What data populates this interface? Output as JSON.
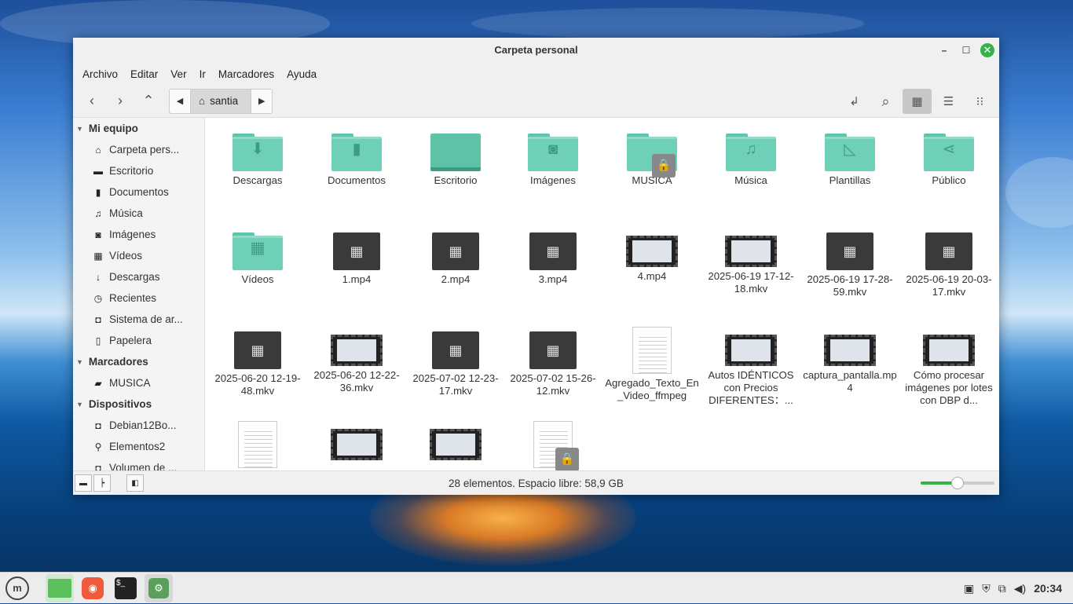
{
  "window": {
    "title": "Carpeta personal"
  },
  "menu": [
    "Archivo",
    "Editar",
    "Ver",
    "Ir",
    "Marcadores",
    "Ayuda"
  ],
  "path": {
    "current": "santia"
  },
  "sidebar": {
    "sections": [
      {
        "title": "Mi equipo",
        "items": [
          {
            "icon": "home-icon",
            "glyph": "⌂",
            "label": "Carpeta pers..."
          },
          {
            "icon": "desktop-icon",
            "glyph": "▬",
            "label": "Escritorio"
          },
          {
            "icon": "document-icon",
            "glyph": "▮",
            "label": "Documentos"
          },
          {
            "icon": "music-icon",
            "glyph": "♫",
            "label": "Música"
          },
          {
            "icon": "camera-icon",
            "glyph": "◙",
            "label": "Imágenes"
          },
          {
            "icon": "film-icon",
            "glyph": "▦",
            "label": "Vídeos"
          },
          {
            "icon": "download-icon",
            "glyph": "↓",
            "label": "Descargas"
          },
          {
            "icon": "clock-icon",
            "glyph": "◷",
            "label": "Recientes"
          },
          {
            "icon": "drive-icon",
            "glyph": "◘",
            "label": "Sistema de ar..."
          },
          {
            "icon": "trash-icon",
            "glyph": "▯",
            "label": "Papelera"
          }
        ]
      },
      {
        "title": "Marcadores",
        "items": [
          {
            "icon": "folder-icon",
            "glyph": "▰",
            "label": "MUSICA"
          }
        ]
      },
      {
        "title": "Dispositivos",
        "items": [
          {
            "icon": "drive-icon",
            "glyph": "◘",
            "label": "Debian12Bo..."
          },
          {
            "icon": "usb-icon",
            "glyph": "⚲",
            "label": "Elementos2"
          },
          {
            "icon": "drive-icon",
            "glyph": "◘",
            "label": "Volumen de ..."
          }
        ]
      }
    ]
  },
  "files": [
    {
      "name": "Descargas",
      "kind": "folder",
      "glyph": "⬇"
    },
    {
      "name": "Documentos",
      "kind": "folder",
      "glyph": "▮"
    },
    {
      "name": "Escritorio",
      "kind": "desktop",
      "glyph": ""
    },
    {
      "name": "Imágenes",
      "kind": "folder",
      "glyph": "◙"
    },
    {
      "name": "MUSICA",
      "kind": "folder-locked",
      "glyph": ""
    },
    {
      "name": "Música",
      "kind": "folder",
      "glyph": "♫"
    },
    {
      "name": "Plantillas",
      "kind": "folder",
      "glyph": "◺"
    },
    {
      "name": "Público",
      "kind": "folder",
      "glyph": "⋖"
    },
    {
      "name": "Vídeos",
      "kind": "folder",
      "glyph": "▦"
    },
    {
      "name": "1.mp4",
      "kind": "video"
    },
    {
      "name": "2.mp4",
      "kind": "video"
    },
    {
      "name": "3.mp4",
      "kind": "video"
    },
    {
      "name": "4.mp4",
      "kind": "thumb"
    },
    {
      "name": "2025-06-19 17-12-18.mkv",
      "kind": "thumb"
    },
    {
      "name": "2025-06-19 17-28-59.mkv",
      "kind": "video"
    },
    {
      "name": "2025-06-19 20-03-17.mkv",
      "kind": "video"
    },
    {
      "name": "2025-06-20 12-19-48.mkv",
      "kind": "video"
    },
    {
      "name": "2025-06-20 12-22-36.mkv",
      "kind": "thumb"
    },
    {
      "name": "2025-07-02 12-23-17.mkv",
      "kind": "video"
    },
    {
      "name": "2025-07-02 15-26-12.mkv",
      "kind": "video"
    },
    {
      "name": "Agregado_Texto_En_Video_ffmpeg",
      "kind": "doc"
    },
    {
      "name": "Autos IDÉNTICOS con Precios DIFERENTES：...",
      "kind": "thumb"
    },
    {
      "name": "captura_pantalla.mp4",
      "kind": "thumb"
    },
    {
      "name": "Cómo procesar imágenes por lotes con DBP d...",
      "kind": "thumb"
    },
    {
      "name": "",
      "kind": "doc"
    },
    {
      "name": "",
      "kind": "thumb"
    },
    {
      "name": "",
      "kind": "thumb"
    },
    {
      "name": "",
      "kind": "doc-locked"
    }
  ],
  "status": {
    "text": "28 elementos. Espacio libre: 58,9 GB",
    "zoom_level": 0.5
  },
  "panel": {
    "clock": "20:34"
  }
}
